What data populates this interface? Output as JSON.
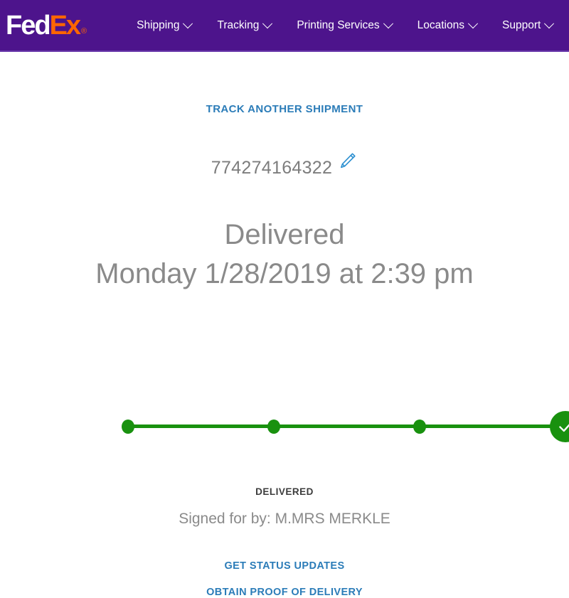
{
  "header": {
    "logo": {
      "part1": "Fed",
      "part2": "Ex",
      "registered": "®"
    },
    "nav": [
      {
        "label": "Shipping",
        "icon": "chevron-down-icon"
      },
      {
        "label": "Tracking",
        "icon": "chevron-down-icon"
      },
      {
        "label": "Printing Services",
        "icon": "chevron-down-icon"
      },
      {
        "label": "Locations",
        "icon": "chevron-down-icon"
      },
      {
        "label": "Support",
        "icon": "chevron-down-icon"
      }
    ],
    "background_color": "#4d148c"
  },
  "main": {
    "track_another_link": "TRACK ANOTHER SHIPMENT",
    "tracking_number": "774274164322",
    "edit_icon": "pencil-icon",
    "status_title": "Delivered",
    "status_date": "Monday 1/28/2019 at 2:39 pm",
    "progress": {
      "steps": 4,
      "completed": 4,
      "final_icon": "check-icon",
      "color": "#19910f"
    },
    "delivered_label": "DELIVERED",
    "signed_for": "Signed for by: M.MRS MERKLE",
    "links": [
      {
        "label": "GET STATUS UPDATES"
      },
      {
        "label": "OBTAIN PROOF OF DELIVERY"
      }
    ],
    "link_color": "#2b7cb8"
  }
}
